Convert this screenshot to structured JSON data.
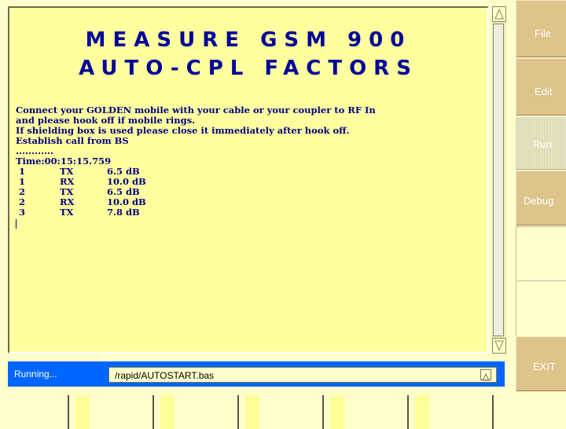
{
  "title": {
    "line1": "MEASURE  GSM  900",
    "line2": "AUTO-CPL  FACTORS"
  },
  "console": {
    "lines": [
      "Connect your GOLDEN mobile with your cable or your coupler to RF In",
      "and please hook off if mobile rings.",
      "If shielding box is used please close it immediately after hook off.",
      "Establish call from BS",
      "............",
      "Time:00:15:15.759"
    ],
    "rows": [
      {
        "ch": "1",
        "dir": "TX",
        "val": "6.5 dB"
      },
      {
        "ch": "1",
        "dir": "RX",
        "val": "10.0 dB"
      },
      {
        "ch": "2",
        "dir": "TX",
        "val": "6.5 dB"
      },
      {
        "ch": "2",
        "dir": "RX",
        "val": "10.0 dB"
      },
      {
        "ch": "3",
        "dir": "TX",
        "val": "7.8 dB"
      }
    ]
  },
  "status": {
    "text": "Running...",
    "script_path": "/rapid/AUTOSTART.bas"
  },
  "softkeys": {
    "file": "File",
    "edit": "Edit",
    "run": "Run",
    "debug": "Debug",
    "exit": "EXIT"
  },
  "colors": {
    "background": "#ffffcc",
    "panel": "#ffffa0",
    "title": "#000099",
    "status_bar": "#0066ff",
    "softkey": "#ddc48a"
  }
}
